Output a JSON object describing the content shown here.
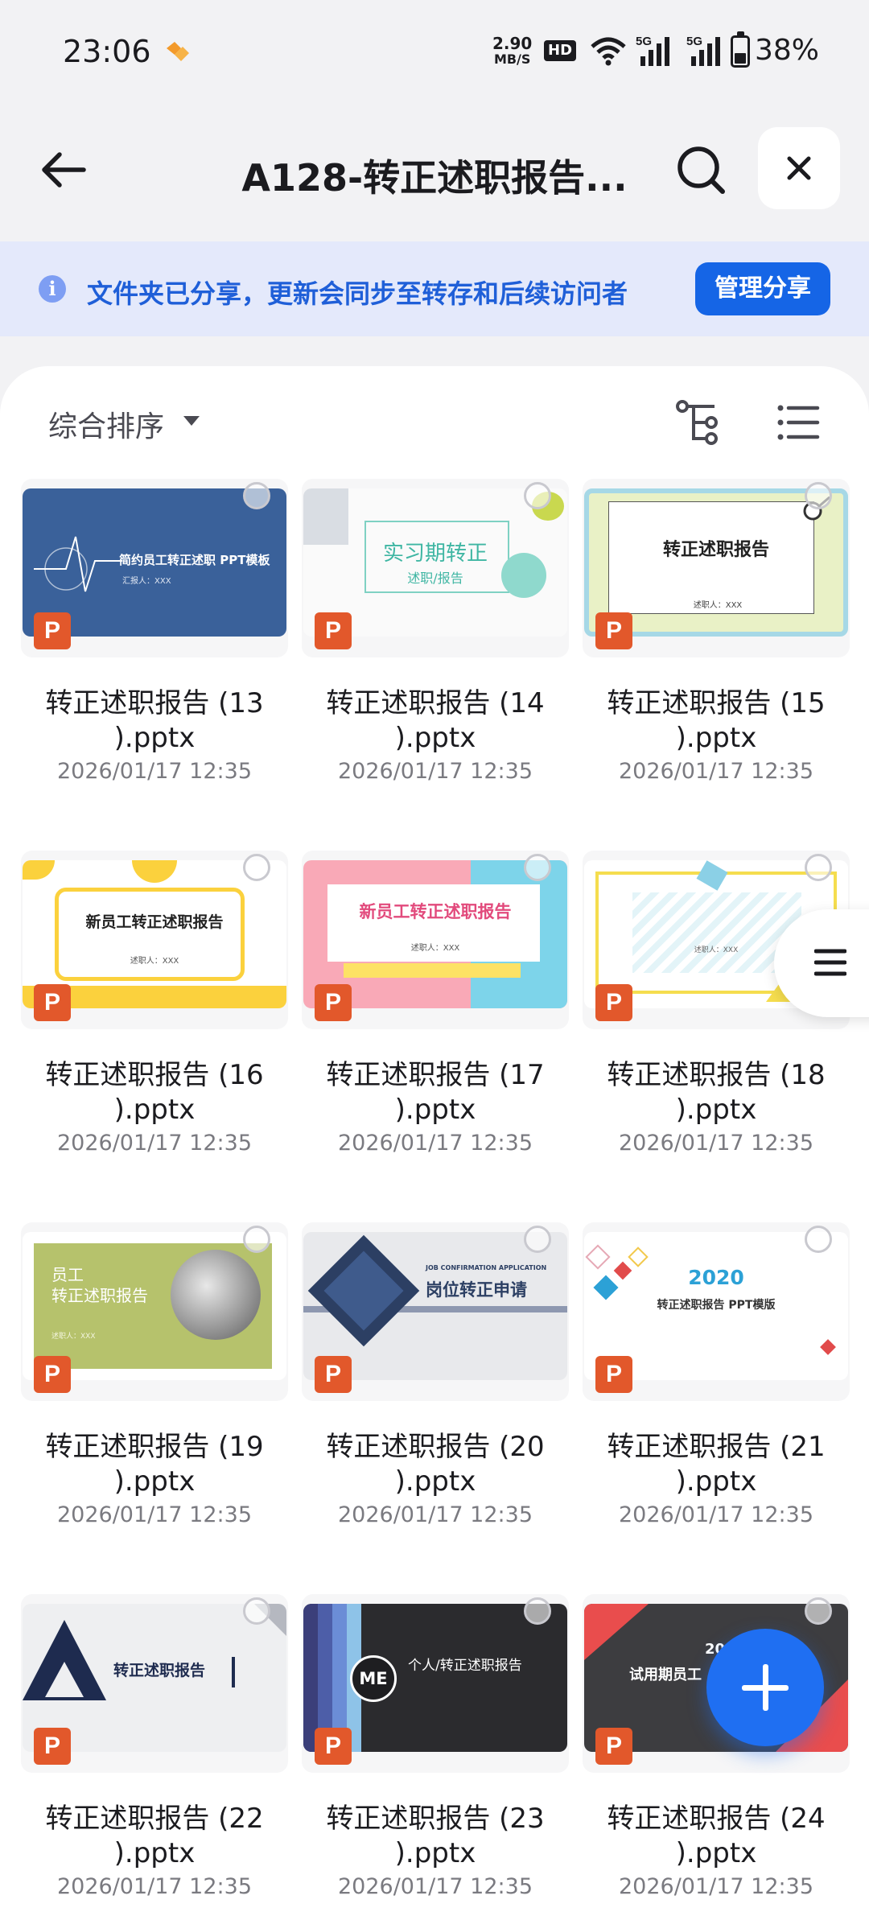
{
  "status_bar": {
    "time": "23:06",
    "net_speed_value": "2.90",
    "net_speed_unit": "MB/S",
    "hd_label": "HD",
    "signal_1": "5G",
    "signal_2": "5G",
    "battery_percent": "38%"
  },
  "header": {
    "title": "A128-转正述职报告...",
    "back_icon": "arrow-left",
    "search_icon": "magnifier",
    "close_icon": "x"
  },
  "banner": {
    "info_icon": "i",
    "text": "文件夹已分享，更新会同步至转存和后续访问者",
    "manage_label": "管理分享"
  },
  "toolbar": {
    "sort_label": "综合排序",
    "tree_icon": "tree-view",
    "list_icon": "list-view"
  },
  "file_type_badge": "P",
  "files": [
    {
      "name": "转正述职报告 (13\n).pptx",
      "date": "2026/01/17 12:35",
      "thumb_text": "简约员工转正述职 PPT模板",
      "thumb_sub": "汇报人：XXX"
    },
    {
      "name": "转正述职报告 (14\n).pptx",
      "date": "2026/01/17 12:35",
      "thumb_text": "实习期转正",
      "thumb_sub": "述职/报告"
    },
    {
      "name": "转正述职报告 (15\n).pptx",
      "date": "2026/01/17 12:35",
      "thumb_text": "转正述职报告",
      "thumb_sub": "述职人：XXX"
    },
    {
      "name": "转正述职报告 (16\n).pptx",
      "date": "2026/01/17 12:35",
      "thumb_text": "新员工转正述职报告",
      "thumb_sub": "述职人：XXX"
    },
    {
      "name": "转正述职报告 (17\n).pptx",
      "date": "2026/01/17 12:35",
      "thumb_text": "新员工转正述职报告",
      "thumb_sub": "述职人：XXX"
    },
    {
      "name": "转正述职报告 (18\n).pptx",
      "date": "2026/01/17 12:35",
      "thumb_text": "",
      "thumb_sub": "述职人：XXX"
    },
    {
      "name": "转正述职报告 (19\n).pptx",
      "date": "2026/01/17 12:35",
      "thumb_text": "员工\n转正述职报告",
      "thumb_sub": "述职人：XXX"
    },
    {
      "name": "转正述职报告 (20\n).pptx",
      "date": "2026/01/17 12:35",
      "thumb_text": "岗位转正申请",
      "thumb_sub": "JOB CONFIRMATION APPLICATION"
    },
    {
      "name": "转正述职报告 (21\n).pptx",
      "date": "2026/01/17 12:35",
      "thumb_text": "2020",
      "thumb_sub": "转正述职报告 PPT模版"
    },
    {
      "name": "转正述职报告 (22\n).pptx",
      "date": "2026/01/17 12:35",
      "thumb_text": "转正述职报告",
      "thumb_sub": ""
    },
    {
      "name": "转正述职报告 (23\n).pptx",
      "date": "2026/01/17 12:35",
      "thumb_text": "个人/转正述职报告",
      "thumb_sub": "ME"
    },
    {
      "name": "转正述职报告 (24\n).pptx",
      "date": "2026/01/17 12:35",
      "thumb_text": "试用期员工",
      "thumb_sub": "20"
    }
  ],
  "side_handle_icon": "menu-lines",
  "fab_icon": "plus",
  "colors": {
    "accent": "#1565e6",
    "banner_bg": "#e4e9fb",
    "ppt_badge": "#e2582b"
  }
}
